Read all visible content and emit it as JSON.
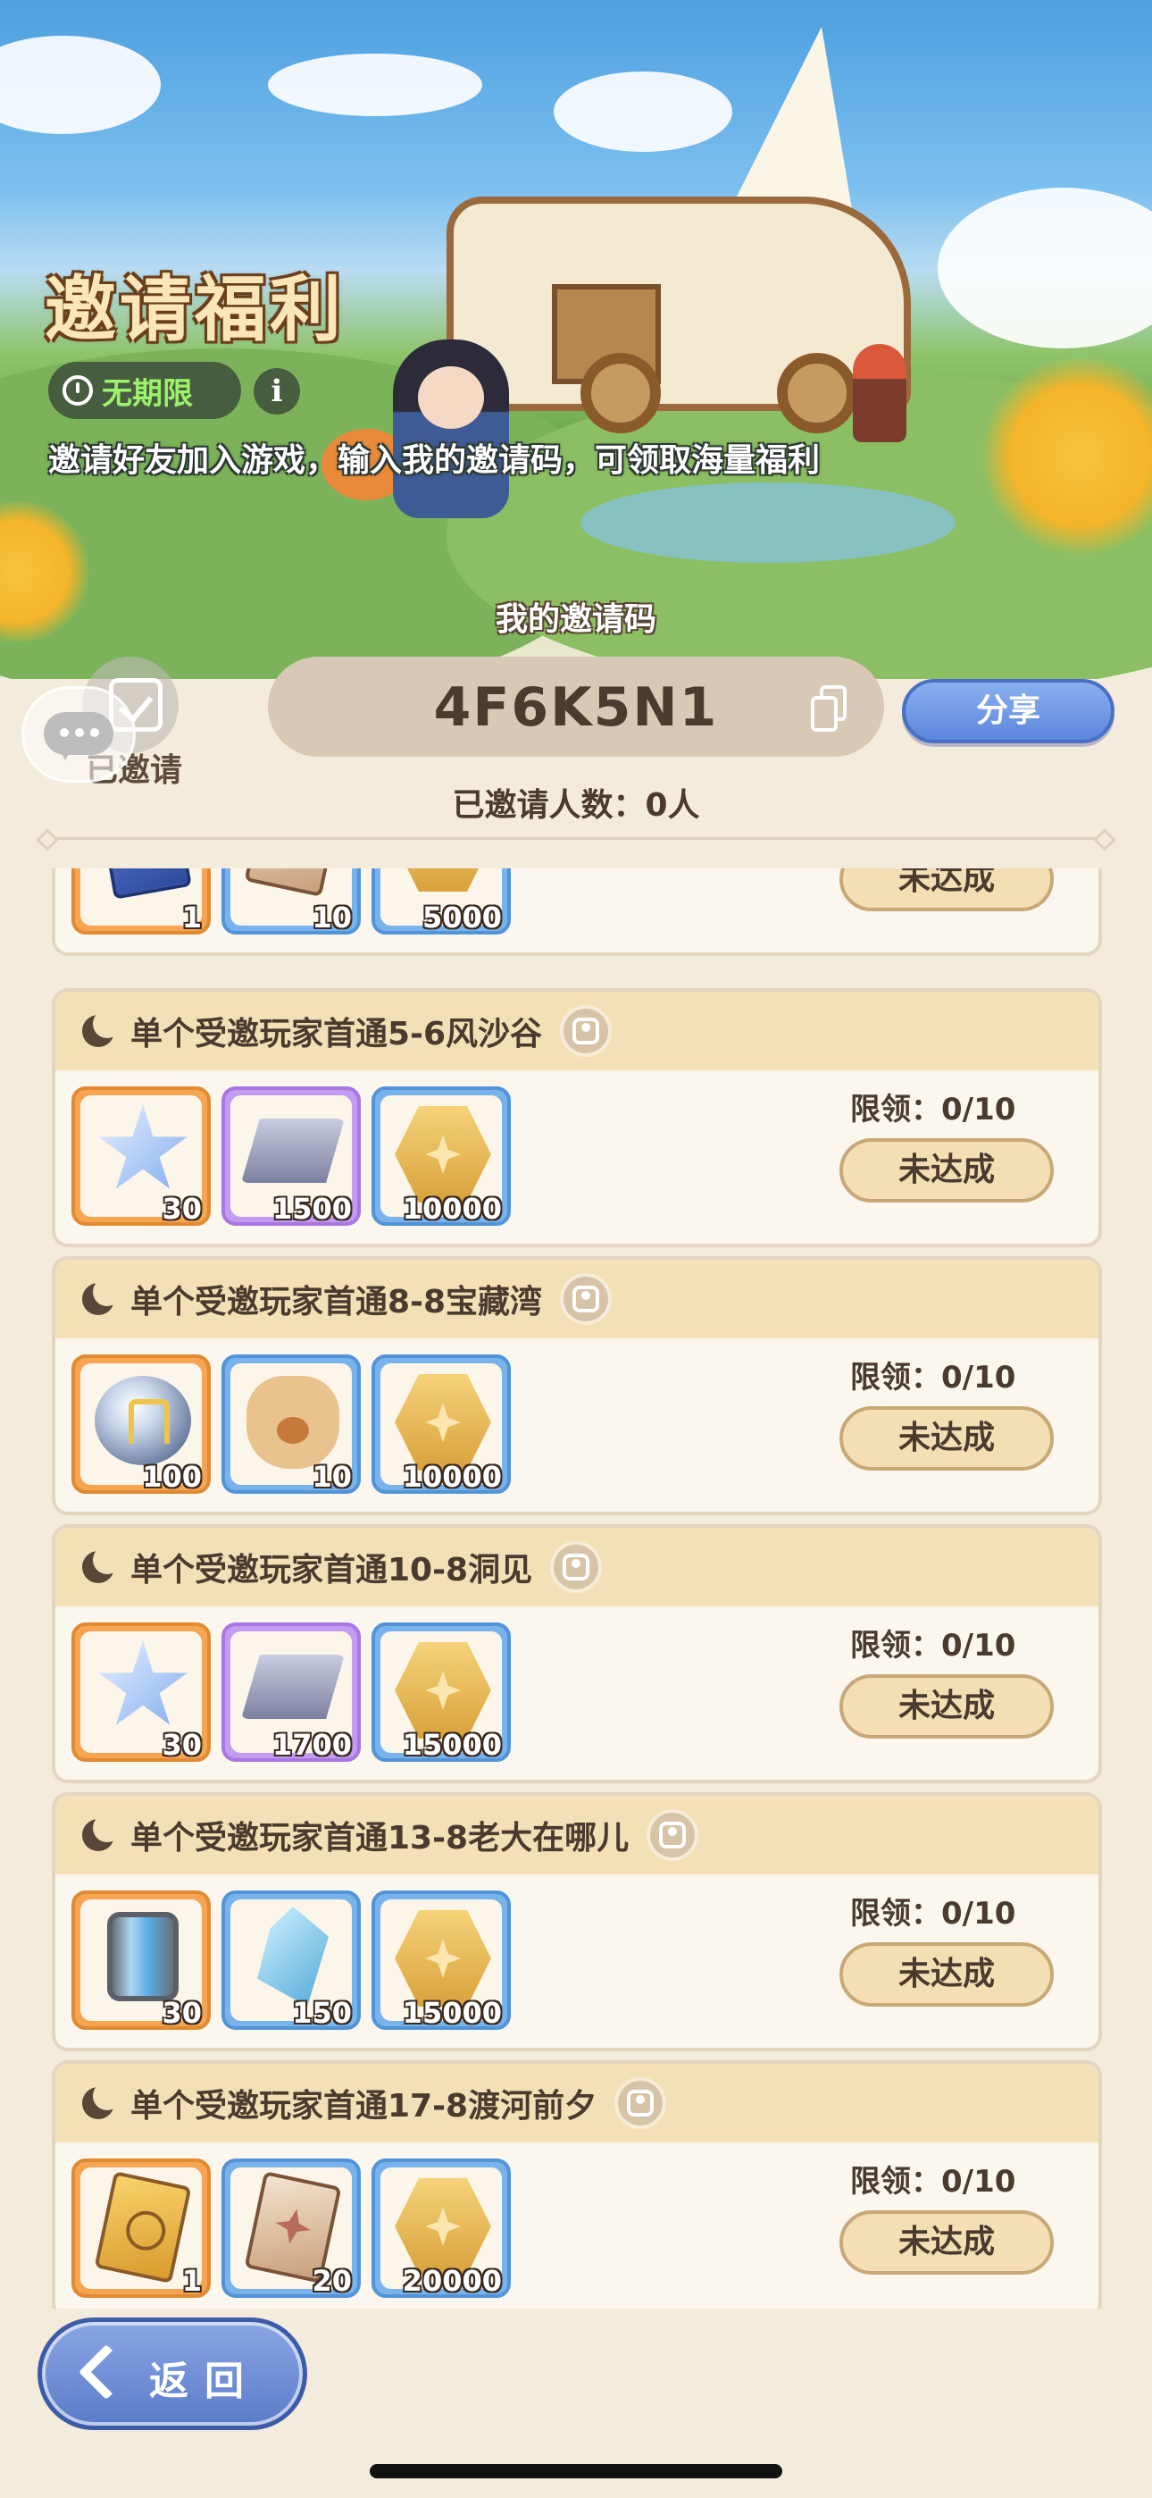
{
  "header": {
    "title": "邀请福利",
    "badge_label": "无期限",
    "info_symbol": "i",
    "description": "邀请好友加入游戏，输入我的邀请码，可领取海量福利"
  },
  "invite": {
    "code_label": "我的邀请码",
    "code_value": "4F6K5N1",
    "share_label": "分享",
    "invited_button_label": "已邀请",
    "invited_count_text": "已邀请人数：0人"
  },
  "missions": [
    {
      "title": "",
      "limit_text": "",
      "button_label": "未达成",
      "rewards": [
        {
          "icon": "blue-card-icon",
          "count": "1",
          "rarity": "orange"
        },
        {
          "icon": "star-card-icon",
          "count": "10",
          "rarity": "blue"
        },
        {
          "icon": "gold-coin-icon",
          "count": "5000",
          "rarity": "blue"
        }
      ]
    },
    {
      "title": "单个受邀玩家首通5-6风沙谷",
      "limit_text": "限领：0/10",
      "button_label": "未达成",
      "rewards": [
        {
          "icon": "star-crystal-icon",
          "count": "30",
          "rarity": "orange"
        },
        {
          "icon": "iron-ingot-icon",
          "count": "1500",
          "rarity": "purple"
        },
        {
          "icon": "gold-coin-icon",
          "count": "10000",
          "rarity": "blue"
        }
      ]
    },
    {
      "title": "单个受邀玩家首通8-8宝藏湾",
      "limit_text": "限领：0/10",
      "button_label": "未达成",
      "rewards": [
        {
          "icon": "rune-orb-icon",
          "count": "100",
          "rarity": "orange"
        },
        {
          "icon": "paw-bag-icon",
          "count": "10",
          "rarity": "blue"
        },
        {
          "icon": "gold-coin-icon",
          "count": "10000",
          "rarity": "blue"
        }
      ]
    },
    {
      "title": "单个受邀玩家首通10-8洞见",
      "limit_text": "限领：0/10",
      "button_label": "未达成",
      "rewards": [
        {
          "icon": "star-crystal-icon",
          "count": "30",
          "rarity": "orange"
        },
        {
          "icon": "iron-ingot-icon",
          "count": "1700",
          "rarity": "purple"
        },
        {
          "icon": "gold-coin-icon",
          "count": "15000",
          "rarity": "blue"
        }
      ]
    },
    {
      "title": "单个受邀玩家首通13-8老大在哪儿",
      "limit_text": "限领：0/10",
      "button_label": "未达成",
      "rewards": [
        {
          "icon": "energy-canister-icon",
          "count": "30",
          "rarity": "orange"
        },
        {
          "icon": "blue-crystal-icon",
          "count": "150",
          "rarity": "blue"
        },
        {
          "icon": "gold-coin-icon",
          "count": "15000",
          "rarity": "blue"
        }
      ]
    },
    {
      "title": "单个受邀玩家首通17-8渡河前夕",
      "limit_text": "限领：0/10",
      "button_label": "未达成",
      "rewards": [
        {
          "icon": "golden-card-icon",
          "count": "1",
          "rarity": "orange"
        },
        {
          "icon": "star-card-icon",
          "count": "20",
          "rarity": "blue"
        },
        {
          "icon": "gold-coin-icon",
          "count": "20000",
          "rarity": "blue"
        }
      ]
    }
  ],
  "footer": {
    "back_label": "返回"
  }
}
